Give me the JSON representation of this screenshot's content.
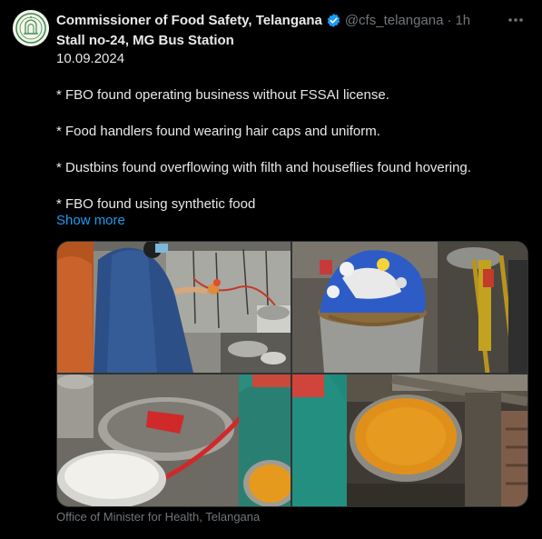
{
  "tweet": {
    "display_name": "Commissioner of Food Safety, Telangana",
    "handle": "@cfs_telangana",
    "separator": "·",
    "time": "1h",
    "verified_icon": "verified-badge-icon",
    "more_icon": "more-options-icon",
    "lines": [
      "Stall no-24, MG Bus Station",
      "10.09.2024",
      "* FBO found operating business without FSSAI license.",
      "* Food handlers found wearing hair caps and uniform.",
      "* Dustbins found overflowing with filth and houseflies found hovering.",
      "* FBO found using synthetic food"
    ],
    "show_more": "Show more",
    "media_caption": "Office of Minister for Health, Telangana"
  },
  "colors": {
    "background": "#000000",
    "text": "#e7e9ea",
    "muted": "#71767b",
    "link": "#1d9bf0",
    "verified": "#1d9bf0"
  }
}
